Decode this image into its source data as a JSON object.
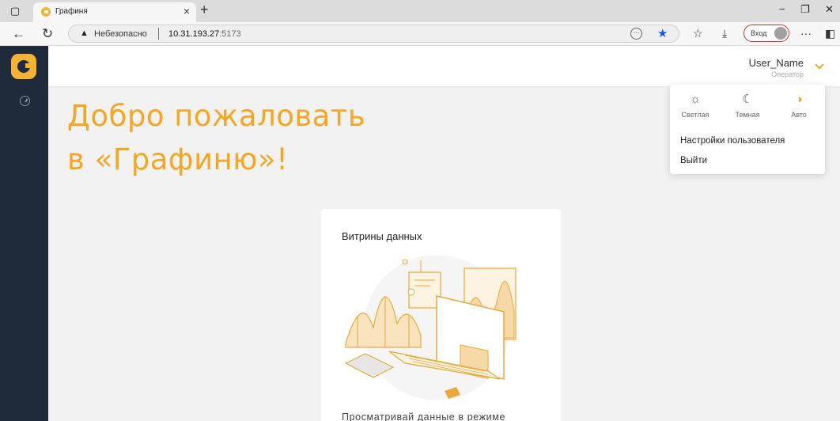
{
  "browser": {
    "tab_title": "Графиня",
    "tab_close": "×",
    "new_tab": "+",
    "security_label": "Небезопасно",
    "url_host": "10.31.193.27",
    "url_port": ":5173",
    "login_label": "Вход"
  },
  "header": {
    "user_name": "User_Name",
    "user_role": "Оператор"
  },
  "main": {
    "welcome_line1": "Добро пожаловать",
    "welcome_line2": "в «Графиню»!",
    "card": {
      "title": "Витрины данных",
      "description": "Просматривай данные в режиме"
    }
  },
  "user_menu": {
    "themes": [
      {
        "label": "Светлая",
        "icon": "sun-icon"
      },
      {
        "label": "Темная",
        "icon": "moon-icon"
      },
      {
        "label": "Авто",
        "icon": "half-circle-icon",
        "active": true
      }
    ],
    "items": [
      {
        "label": "Настройки пользователя"
      },
      {
        "label": "Выйти"
      }
    ]
  },
  "colors": {
    "accent": "#f5a623",
    "sidebar": "#1f2a3a",
    "insecure_border": "#c0392b"
  }
}
